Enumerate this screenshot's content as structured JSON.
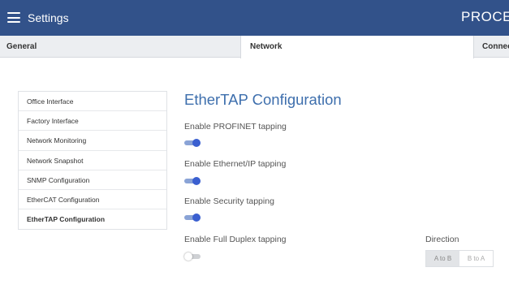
{
  "header": {
    "title": "Settings",
    "brand": "PROCE",
    "menu_icon": "hamburger-menu-icon",
    "background_color": "#32528a"
  },
  "tabs": [
    {
      "label": "General",
      "active": false
    },
    {
      "label": "Network",
      "active": true
    },
    {
      "label": "Connec",
      "active": false
    }
  ],
  "sidebar": {
    "items": [
      {
        "label": "Office Interface",
        "active": false
      },
      {
        "label": "Factory Interface",
        "active": false
      },
      {
        "label": "Network Monitoring",
        "active": false
      },
      {
        "label": "Network Snapshot",
        "active": false
      },
      {
        "label": "SNMP Configuration",
        "active": false
      },
      {
        "label": "EtherCAT Configuration",
        "active": false
      },
      {
        "label": "EtherTAP Configuration",
        "active": true
      }
    ]
  },
  "main": {
    "title": "EtherTAP Configuration",
    "title_color": "#3e6fad",
    "options": [
      {
        "label": "Enable PROFINET tapping",
        "enabled": true
      },
      {
        "label": "Enable Ethernet/IP tapping",
        "enabled": true
      },
      {
        "label": "Enable Security tapping",
        "enabled": true
      },
      {
        "label": "Enable Full Duplex tapping",
        "enabled": false
      }
    ],
    "direction": {
      "label": "Direction",
      "options": [
        "A to B",
        "B to A"
      ],
      "selected": "A to B"
    },
    "toggle_on_color": "#3a5fd0"
  }
}
